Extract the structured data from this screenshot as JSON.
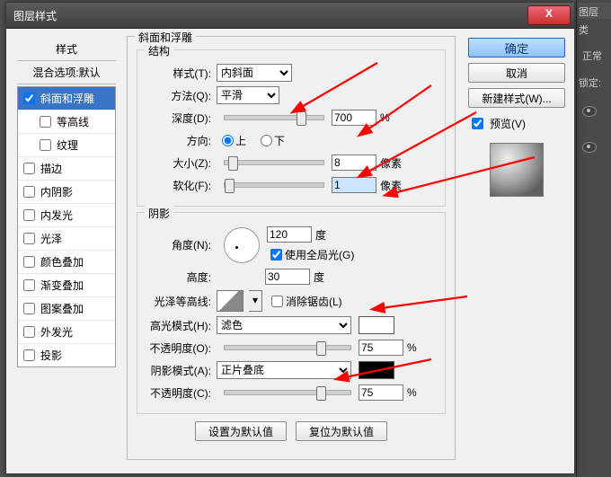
{
  "pspanel": {
    "tab1": "图层",
    "tab2": "类",
    "mode": "正常",
    "lock": "锁定:"
  },
  "dialog": {
    "title": "图层样式",
    "close_glyph": "X",
    "styles_header": "样式",
    "blend_options": "混合选项:默认",
    "effects": [
      {
        "label": "斜面和浮雕",
        "checked": true,
        "sel": true
      },
      {
        "label": "等高线",
        "checked": false,
        "child": true
      },
      {
        "label": "纹理",
        "checked": false,
        "child": true
      },
      {
        "label": "描边",
        "checked": false
      },
      {
        "label": "内阴影",
        "checked": false
      },
      {
        "label": "内发光",
        "checked": false
      },
      {
        "label": "光泽",
        "checked": false
      },
      {
        "label": "颜色叠加",
        "checked": false
      },
      {
        "label": "渐变叠加",
        "checked": false
      },
      {
        "label": "图案叠加",
        "checked": false
      },
      {
        "label": "外发光",
        "checked": false
      },
      {
        "label": "投影",
        "checked": false
      }
    ],
    "group_title": "斜面和浮雕",
    "structure": {
      "legend": "结构",
      "style_lbl": "样式(T):",
      "style_val": "内斜面",
      "technique_lbl": "方法(Q):",
      "technique_val": "平滑",
      "depth_lbl": "深度(D):",
      "depth_val": "700",
      "depth_unit": "%",
      "direction_lbl": "方向:",
      "up": "上",
      "down": "下",
      "size_lbl": "大小(Z):",
      "size_val": "8",
      "size_unit": "像素",
      "soften_lbl": "软化(F):",
      "soften_val": "1",
      "soften_unit": "像素"
    },
    "shading": {
      "legend": "阴影",
      "angle_lbl": "角度(N):",
      "angle_val": "120",
      "angle_unit": "度",
      "global_light": "使用全局光(G)",
      "altitude_lbl": "高度:",
      "altitude_val": "30",
      "altitude_unit": "度",
      "gloss_lbl": "光泽等高线:",
      "antialias": "消除锯齿(L)",
      "highlight_mode_lbl": "高光模式(H):",
      "highlight_mode_val": "滤色",
      "highlight_color": "#ffffff",
      "highlight_opacity_lbl": "不透明度(O):",
      "highlight_opacity_val": "75",
      "pct": "%",
      "shadow_mode_lbl": "阴影模式(A):",
      "shadow_mode_val": "正片叠底",
      "shadow_color": "#000000",
      "shadow_opacity_lbl": "不透明度(C):",
      "shadow_opacity_val": "75"
    },
    "set_default": "设置为默认值",
    "reset_default": "复位为默认值",
    "ok": "确定",
    "cancel": "取消",
    "new_style": "新建样式(W)...",
    "preview": "预览(V)"
  }
}
